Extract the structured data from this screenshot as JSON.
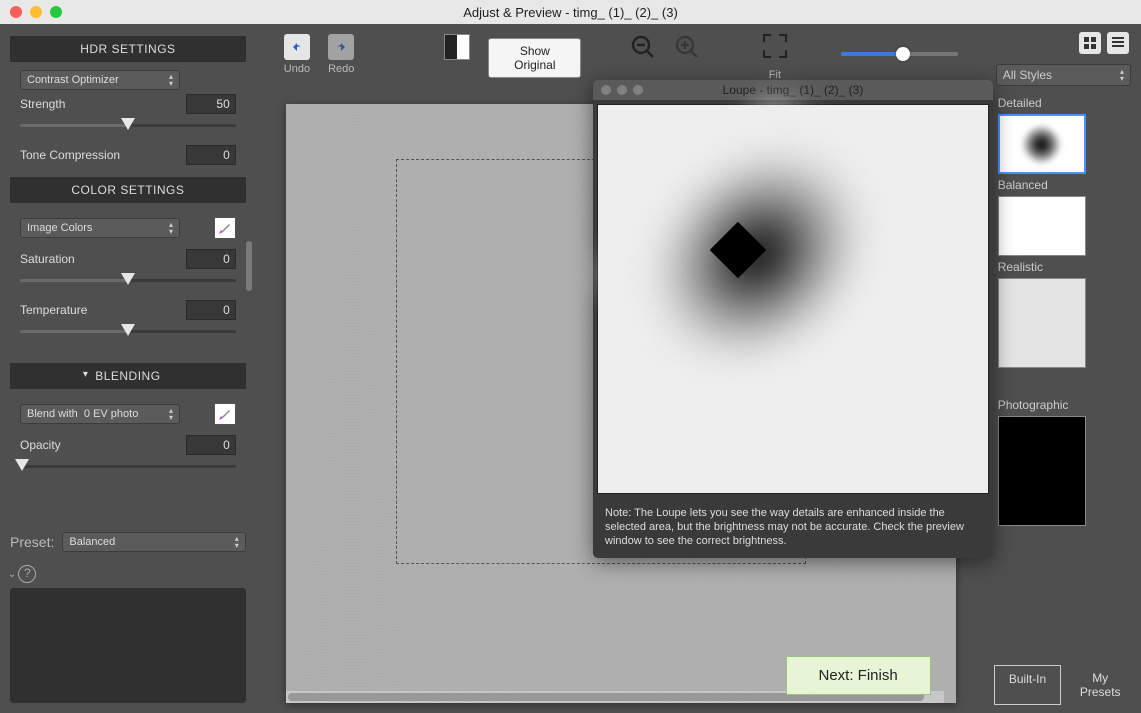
{
  "window": {
    "title": "Adjust & Preview - timg_ (1)_ (2)_ (3)"
  },
  "hdr": {
    "header": "HDR SETTINGS",
    "method_selected": "Contrast Optimizer",
    "strength_label": "Strength",
    "strength_value": "50",
    "tone_label": "Tone Compression",
    "tone_value": "0"
  },
  "color": {
    "header": "COLOR SETTINGS",
    "mode_selected": "Image Colors",
    "saturation_label": "Saturation",
    "saturation_value": "0",
    "temperature_label": "Temperature",
    "temperature_value": "0"
  },
  "blending": {
    "header": "BLENDING",
    "blend_label": "Blend with",
    "blend_selected": "0 EV photo",
    "opacity_label": "Opacity",
    "opacity_value": "0"
  },
  "preset": {
    "label": "Preset:",
    "selected": "Balanced"
  },
  "toolbar": {
    "undo": "Undo",
    "redo": "Redo",
    "show_original": "Show Original",
    "fit": "Fit"
  },
  "loupe": {
    "title": "Loupe - timg_ (1)_ (2)_ (3)",
    "note": "Note: The Loupe lets you see the way details are enhanced inside the selected area, but the brightness may not be accurate. Check the preview window to see the correct brightness."
  },
  "next_button": "Next: Finish",
  "presets_panel": {
    "all_styles": "All Styles",
    "items": [
      "Detailed",
      "Balanced",
      "Realistic",
      "Photographic"
    ],
    "tabs": {
      "builtin": "Built-In",
      "my": "My Presets"
    }
  }
}
